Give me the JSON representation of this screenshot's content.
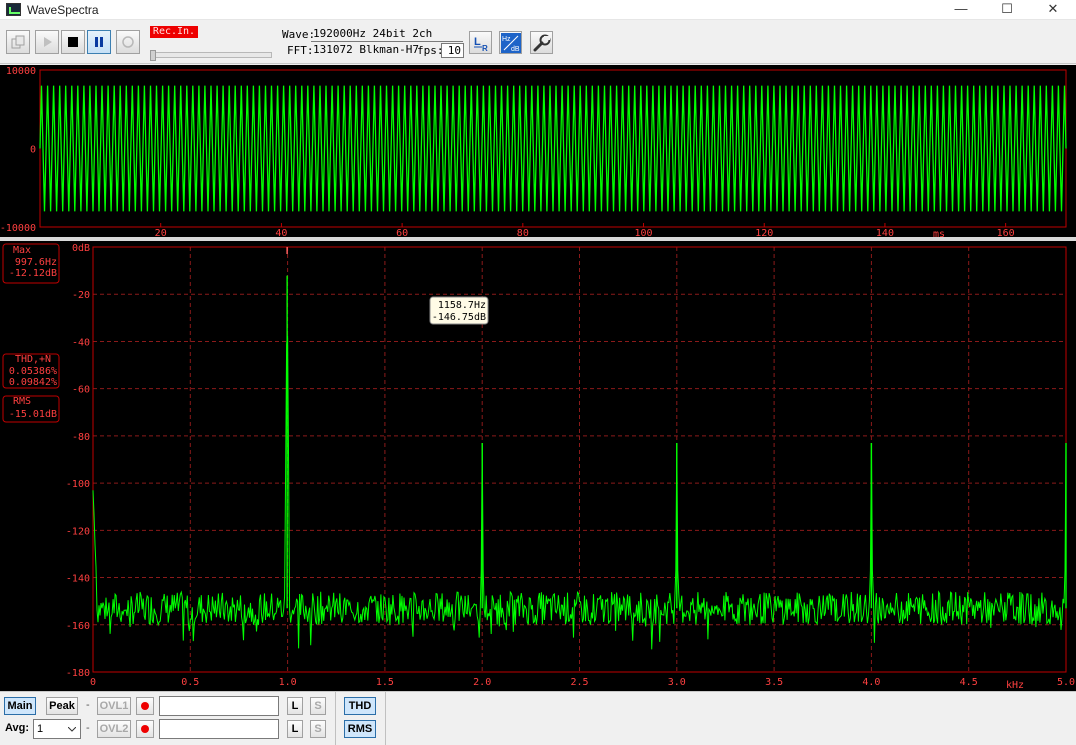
{
  "window": {
    "title": "WaveSpectra",
    "minimize": "—",
    "maximize": "☐",
    "close": "✕"
  },
  "colors": {
    "trace": "#00ff00",
    "frame": "#c00000",
    "grid": "#8b1a1a",
    "text": "#ff4040",
    "info_bg": "#fffbe6"
  },
  "toolbar": {
    "rec_label": "Rec.In.",
    "wave_label": "Wave:",
    "wave_value": "192000Hz 24bit 2ch",
    "fft_label": "FFT:",
    "fft_value": "131072 Blkman-H7",
    "fps_label": "fps:",
    "fps_value": "10",
    "lr_icon": "L R",
    "hzdb_icon": "Hz dB"
  },
  "waveform": {
    "y_ticks": [
      "10000",
      "0",
      "-10000"
    ],
    "x_ticks": [
      "20",
      "40",
      "60",
      "80",
      "100",
      "120",
      "140",
      "160"
    ],
    "x_unit": "ms"
  },
  "spectrum": {
    "y_ticks": [
      "0dB",
      "-20",
      "-40",
      "-60",
      "-80",
      "-100",
      "-120",
      "-140",
      "-160",
      "-180"
    ],
    "x_ticks": [
      "0",
      "0.5",
      "1.0",
      "1.5",
      "2.0",
      "2.5",
      "3.0",
      "3.5",
      "4.0",
      "4.5",
      "5.0"
    ],
    "x_unit": "kHz",
    "max_label": "Max",
    "max_freq": "997.6Hz",
    "max_db": "-12.12dB",
    "thd_label": "THD,+N",
    "thd_value": "0.05386%",
    "thdn_value": "0.09842%",
    "rms_label": "RMS",
    "rms_value": "-15.01dB",
    "cursor_freq": "1158.7Hz",
    "cursor_db": "-146.75dB"
  },
  "chart_data": {
    "type": "line",
    "x_unit": "kHz",
    "xlim": [
      0,
      5.0
    ],
    "ylim": [
      -180,
      0
    ],
    "noise_floor_db": -153,
    "peaks": [
      {
        "x": 0.9976,
        "y": -12.12
      },
      {
        "x": 2.0,
        "y": -83
      },
      {
        "x": 3.0,
        "y": -83
      },
      {
        "x": 4.0,
        "y": -83
      },
      {
        "x": 5.0,
        "y": -83
      }
    ],
    "waveform": {
      "type": "line",
      "x_unit": "ms",
      "xlim": [
        0,
        170
      ],
      "ylim": [
        -10000,
        10000
      ],
      "amplitude": 8000,
      "frequency_hz": 997.6
    }
  },
  "bottom": {
    "main_label": "Main",
    "peak_label": "Peak",
    "ovl1_label": "OVL1",
    "ovl2_label": "OVL2",
    "avg_label": "Avg:",
    "avg_value": "1",
    "dash": "-",
    "l_label": "L",
    "s_label": "S",
    "thd_button": "THD",
    "rms_button": "RMS"
  }
}
